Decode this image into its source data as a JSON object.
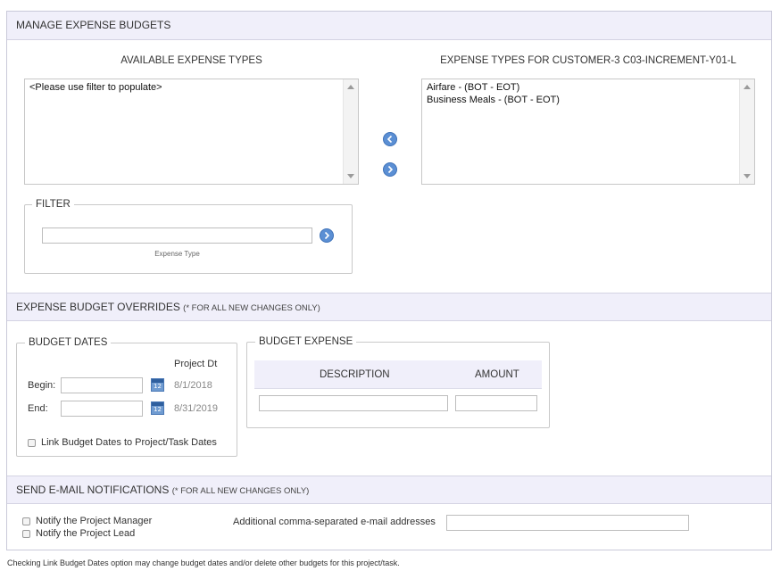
{
  "header": {
    "title": "MANAGE EXPENSE BUDGETS"
  },
  "available": {
    "title": "AVAILABLE EXPENSE TYPES",
    "items": [
      "<Please use filter to populate>"
    ]
  },
  "selected": {
    "title": "EXPENSE TYPES FOR CUSTOMER-3 C03-INCREMENT-Y01-L",
    "items": [
      "Airfare - (BOT - EOT)",
      "Business Meals - (BOT - EOT)"
    ]
  },
  "filter": {
    "legend": "FILTER",
    "value": "",
    "caption": "Expense Type"
  },
  "overrides": {
    "title": "EXPENSE BUDGET OVERRIDES",
    "note": "(* FOR ALL NEW CHANGES ONLY)"
  },
  "budget_dates": {
    "legend": "BUDGET DATES",
    "project_dt_header": "Project Dt",
    "begin_label": "Begin:",
    "begin_value": "",
    "begin_project": "8/1/2018",
    "end_label": "End:",
    "end_value": "",
    "end_project": "8/31/2019",
    "calendar_day": "12",
    "link_label": "Link Budget Dates to Project/Task Dates"
  },
  "budget_expense": {
    "legend": "BUDGET EXPENSE",
    "col_description": "DESCRIPTION",
    "col_amount": "AMOUNT",
    "description_value": "",
    "amount_value": ""
  },
  "notifications": {
    "title": "SEND E-MAIL NOTIFICATIONS",
    "note": "(* FOR ALL NEW CHANGES ONLY)",
    "notify_pm": "Notify the Project Manager",
    "notify_lead": "Notify the Project Lead",
    "additional_label": "Additional comma-separated e-mail addresses",
    "additional_value": ""
  },
  "footnote": "Checking Link Budget Dates option may change budget dates and/or delete other budgets for this project/task.",
  "colors": {
    "accent": "#5b8fd4",
    "header_bg": "#f0effa",
    "border": "#c9c9d9"
  },
  "icons": [
    "chevron-left-icon",
    "chevron-right-icon",
    "calendar-icon"
  ]
}
